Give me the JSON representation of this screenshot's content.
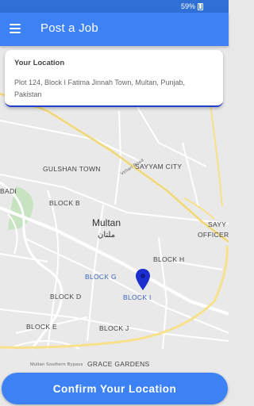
{
  "status_bar": {
    "battery": "59%"
  },
  "app_bar": {
    "title": "Post a Job",
    "menu_icon": "hamburger-menu-icon"
  },
  "location_card": {
    "label": "Your Location",
    "address": "Plot 124, Block I Fatima Jinnah Town, Multan, Punjab, Pakistan"
  },
  "map": {
    "areas": [
      "GULSHAN TOWN",
      "SAYYAM CITY",
      "BLOCK B",
      "BADI",
      "BLOCK H",
      "BLOCK G",
      "BLOCK I",
      "BLOCK D",
      "BLOCK E",
      "BLOCK J",
      "GRACE GARDENS",
      "SAYY",
      "OFFICERS"
    ],
    "city": "Multan",
    "city_urdu": "ملتان",
    "roads": [
      "Vehari Road",
      "Multan Southern Bypass"
    ],
    "pin_icon": "location-pin-icon"
  },
  "confirm_button": {
    "label": "Confirm Your Location"
  }
}
